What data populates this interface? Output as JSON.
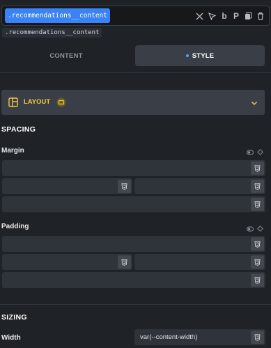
{
  "selector": {
    "chip_label": ".recommendations__content",
    "class_tag": ".recommendations__content",
    "icons": [
      "close-icon",
      "pointer-icon",
      "bold-b-icon",
      "paragraph-p-icon",
      "copy-icon",
      "trash-icon"
    ],
    "bold_glyph": "b",
    "paragraph_glyph": "P"
  },
  "tabs": [
    {
      "label": "CONTENT",
      "active": false
    },
    {
      "label": "STYLE",
      "active": true
    }
  ],
  "layout_section": {
    "title": "LAYOUT"
  },
  "spacing": {
    "title": "SPACING",
    "margin_label": "Margin",
    "padding_label": "Padding"
  },
  "sizing": {
    "title": "SIZING",
    "width_label": "Width",
    "width_value": "var(--content-width)"
  },
  "colors": {
    "background": "#1f2227",
    "accent": "#3b82f6",
    "layout_title": "#f6c744",
    "field": "#2f333a"
  }
}
